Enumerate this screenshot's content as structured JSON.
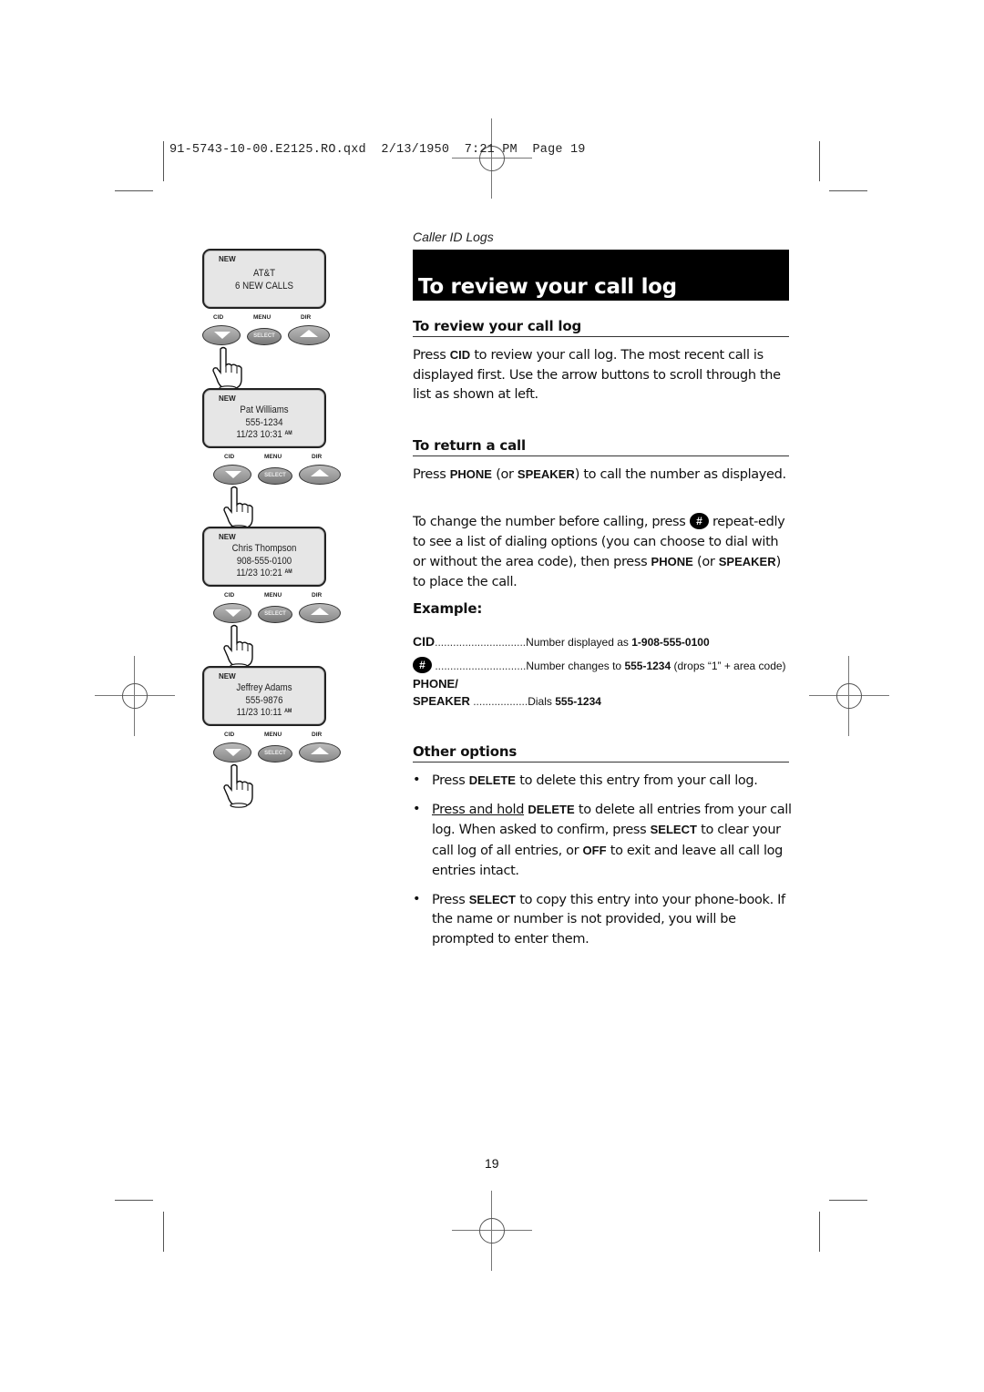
{
  "slug": "91-5743-10-00.E2125.RO.qxd  2/13/1950  7:21 PM  Page 19",
  "section_label": "Caller ID Logs",
  "banner_title": "To review your call log",
  "phones": [
    {
      "badge": "NEW",
      "lines": [
        "AT&T",
        "6 NEW CALLS"
      ],
      "time": "",
      "ampm": ""
    },
    {
      "badge": "NEW",
      "lines": [
        "Pat Williams",
        "555-1234"
      ],
      "time": "11/23 10:31",
      "ampm": "AM"
    },
    {
      "badge": "NEW",
      "lines": [
        "Chris Thompson",
        "908-555-0100"
      ],
      "time": "11/23 10:21",
      "ampm": "AM"
    },
    {
      "badge": "NEW",
      "lines": [
        "Jeffrey Adams",
        "555-9876"
      ],
      "time": "11/23 10:11",
      "ampm": "AM"
    }
  ],
  "keypad": {
    "cid": "CID",
    "menu": "MENU",
    "dir": "DIR",
    "select": "SELECT"
  },
  "review": {
    "heading": "To review your call log",
    "p1": "Press",
    "k1": "CID",
    "p2": "to review your call log. The most recent call is displayed first. Use the arrow buttons to scroll through the list as shown at left."
  },
  "return_call": {
    "heading": "To return a call",
    "a1": "Press",
    "phone": "PHONE",
    "a2": "(or",
    "speaker": "SPEAKER",
    "a3": ") to call the number as displayed.",
    "b1": "To change the number before calling, press",
    "hash": "#",
    "b2": "repeat-edly to see a list of dialing options (you can choose to dial with or without the area code), then press",
    "b3": "(or",
    "b4": ") to place the call."
  },
  "example": {
    "heading": "Example:",
    "rows": [
      {
        "key": "CID",
        "dots": "..............................",
        "text": "Number displayed as ",
        "bold": "1-908-555-0100",
        "tail": ""
      },
      {
        "key": "#",
        "dots": "..............................",
        "text": "Number changes to ",
        "bold": "555-1234",
        "tail": " (drops “1” + area code)"
      },
      {
        "key": "PHONE/",
        "dots": "",
        "text": "",
        "bold": "",
        "tail": ""
      },
      {
        "key": "SPEAKER",
        "dots": " ..................",
        "text": "Dials ",
        "bold": "555-1234",
        "tail": ""
      }
    ]
  },
  "other": {
    "heading": "Other options",
    "bullets": [
      {
        "pre": "Press",
        "key": "DELETE",
        "post": "to delete this entry from your call log."
      },
      {
        "underline": "Press and hold",
        "key": "DELETE",
        "post1": "to delete all entries from your call log. When asked to confirm, press",
        "key2": "SELECT",
        "post2": "to clear your call log of all entries, or",
        "key3": "OFF",
        "post3": "to exit and leave all call log entries intact."
      },
      {
        "pre": "Press",
        "key": "SELECT",
        "post": "to copy this entry into your phone-book. If the name or number is not provided, you will be prompted to enter them."
      }
    ]
  },
  "page_number": "19"
}
